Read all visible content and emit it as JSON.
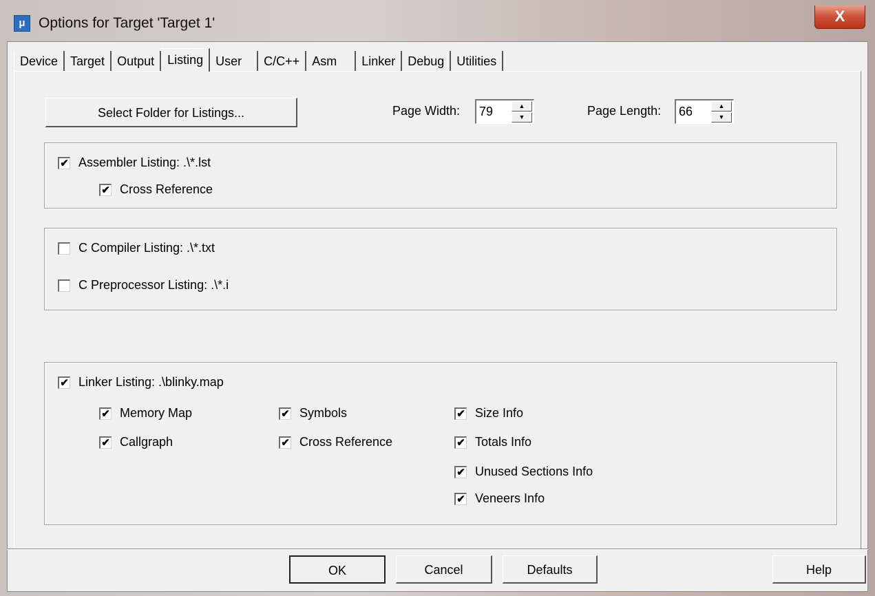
{
  "window": {
    "title": "Options for Target 'Target 1'",
    "close_glyph": "X",
    "app_icon": "keil-uvision-icon"
  },
  "tabs": [
    {
      "label": "Device"
    },
    {
      "label": "Target"
    },
    {
      "label": "Output"
    },
    {
      "label": "Listing",
      "active": true
    },
    {
      "label": "User"
    },
    {
      "label": "C/C++"
    },
    {
      "label": "Asm"
    },
    {
      "label": "Linker"
    },
    {
      "label": "Debug"
    },
    {
      "label": "Utilities"
    }
  ],
  "listing": {
    "select_folder_label": "Select Folder for Listings...",
    "page_width_label": "Page Width:",
    "page_width_value": "79",
    "page_length_label": "Page Length:",
    "page_length_value": "66",
    "assembler_listing": {
      "label": "Assembler Listing:  .\\*.lst",
      "checked": true
    },
    "assembler_cross_ref": {
      "label": "Cross Reference",
      "checked": true
    },
    "c_compiler_listing": {
      "label": "C Compiler Listing:  .\\*.txt",
      "checked": false
    },
    "c_preprocessor_listing": {
      "label": "C Preprocessor Listing:  .\\*.i",
      "checked": false
    },
    "linker_listing": {
      "label": "Linker Listing:  .\\blinky.map",
      "checked": true
    },
    "linker_options": {
      "memory_map": {
        "label": "Memory Map",
        "checked": true
      },
      "callgraph": {
        "label": "Callgraph",
        "checked": true
      },
      "symbols": {
        "label": "Symbols",
        "checked": true
      },
      "cross_reference": {
        "label": "Cross Reference",
        "checked": true
      },
      "size_info": {
        "label": "Size Info",
        "checked": true
      },
      "totals_info": {
        "label": "Totals Info",
        "checked": true
      },
      "unused_sections_info": {
        "label": "Unused Sections Info",
        "checked": true
      },
      "veneers_info": {
        "label": "Veneers Info",
        "checked": true
      }
    }
  },
  "buttons": {
    "ok": "OK",
    "cancel": "Cancel",
    "defaults": "Defaults",
    "help": "Help"
  },
  "check_glyph": "✔",
  "spin_up_glyph": "▲",
  "spin_down_glyph": "▼"
}
